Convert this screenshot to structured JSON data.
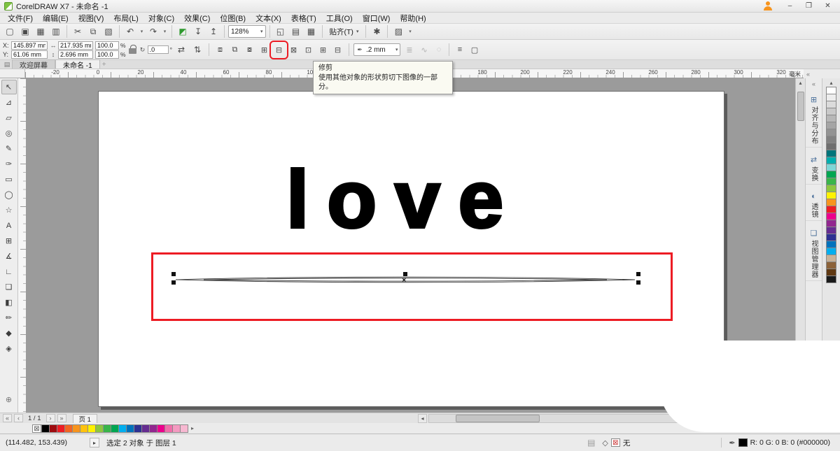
{
  "window": {
    "title": "CorelDRAW X7 - 未命名 -1"
  },
  "titlebar_icons": {
    "minimize": "–",
    "maximize": "❐",
    "close": "✕"
  },
  "icons": {
    "new_tab": "+",
    "doc": "▤",
    "collapse": "«",
    "up": "▴",
    "down": "▾",
    "left": "◂",
    "right": "▸",
    "none": "⊠",
    "clipboard": "▤",
    "nav": "▸",
    "fill": "◇",
    "outline_pen": "✒"
  },
  "menu": {
    "items": [
      {
        "id": "file",
        "label": "文件(F)"
      },
      {
        "id": "edit",
        "label": "编辑(E)"
      },
      {
        "id": "view",
        "label": "视图(V)"
      },
      {
        "id": "layout",
        "label": "布局(L)"
      },
      {
        "id": "object",
        "label": "对象(C)"
      },
      {
        "id": "effects",
        "label": "效果(C)"
      },
      {
        "id": "bitmaps",
        "label": "位图(B)"
      },
      {
        "id": "text",
        "label": "文本(X)"
      },
      {
        "id": "table",
        "label": "表格(T)"
      },
      {
        "id": "tools",
        "label": "工具(O)"
      },
      {
        "id": "window",
        "label": "窗口(W)"
      },
      {
        "id": "help",
        "label": "帮助(H)"
      }
    ]
  },
  "toolbar_std": {
    "zoom_value": "128%",
    "snap_label": "贴齐(T)",
    "items": [
      {
        "name": "new-document-button",
        "glyph": "▢"
      },
      {
        "name": "open-button",
        "glyph": "▣"
      },
      {
        "name": "save-button",
        "glyph": "▦"
      },
      {
        "name": "print-button",
        "glyph": "▥"
      },
      {
        "sep": true
      },
      {
        "name": "cut-button",
        "glyph": "✂"
      },
      {
        "name": "copy-button",
        "glyph": "⧉"
      },
      {
        "name": "paste-button",
        "glyph": "▧"
      },
      {
        "sep": true
      },
      {
        "name": "undo-button",
        "glyph": "↶",
        "dd": true
      },
      {
        "name": "redo-button",
        "glyph": "↷",
        "dd": true
      },
      {
        "sep": true
      },
      {
        "name": "welcome-screen-button",
        "glyph": "◩",
        "cls": "green"
      },
      {
        "name": "import-button",
        "glyph": "↧"
      },
      {
        "name": "export-button",
        "glyph": "↥"
      },
      {
        "sep": true
      },
      {
        "kind": "zoom"
      },
      {
        "sep": true
      },
      {
        "name": "full-screen-preview-button",
        "glyph": "◱"
      },
      {
        "name": "show-rulers-button",
        "glyph": "▤"
      },
      {
        "name": "show-grid-button",
        "glyph": "▦"
      },
      {
        "sep": true
      },
      {
        "kind": "snap"
      },
      {
        "sep": true
      },
      {
        "name": "options-button",
        "glyph": "✱"
      },
      {
        "sep": true
      },
      {
        "name": "application-launcher-button",
        "glyph": "▨",
        "dd": true
      }
    ]
  },
  "property_bar": {
    "x_label": "X:",
    "y_label": "Y:",
    "x_value": "145.897 mm",
    "y_value": "61.06 mm",
    "width_value": "217.935 mm",
    "height_value": "2.696 mm",
    "scale_h": "100.0",
    "scale_v": "100.0",
    "percent": "%",
    "angle": ".0",
    "degree": "°",
    "outline_value": ".2 mm",
    "shaping": [
      {
        "name": "group-button",
        "glyph": "⧈"
      },
      {
        "name": "ungroup-button",
        "glyph": "⧉"
      },
      {
        "name": "ungroup-all-button",
        "glyph": "⧇"
      },
      {
        "name": "weld-button",
        "glyph": "⊞"
      },
      {
        "name": "trim-button",
        "glyph": "⊟",
        "highlight": true
      },
      {
        "name": "intersect-button",
        "glyph": "⊠"
      },
      {
        "name": "simplify-button",
        "glyph": "⊡"
      },
      {
        "name": "front-minus-back-button",
        "glyph": "⊞"
      },
      {
        "name": "back-minus-front-button",
        "glyph": "⊟"
      }
    ],
    "extra": [
      {
        "name": "wrap-paragraph-text-button",
        "glyph": "≣",
        "dis": true
      },
      {
        "name": "convert-to-curves-button",
        "glyph": "∿",
        "dis": true
      },
      {
        "name": "open-curve-button",
        "glyph": "◌",
        "dis": true
      },
      {
        "sep": true
      },
      {
        "name": "align-and-distribute-button",
        "glyph": "≡"
      },
      {
        "name": "create-boundary-button",
        "glyph": "▢"
      }
    ]
  },
  "tooltip": {
    "title": "修剪",
    "body": "使用其他对象的形状剪切下图像的一部分。"
  },
  "doc_tabs": {
    "tabs": [
      {
        "label": "欢迎屏幕",
        "active": false
      },
      {
        "label": "未命名 -1",
        "active": true
      }
    ]
  },
  "ruler": {
    "unit": "毫米",
    "labels": [
      -20,
      0,
      20,
      40,
      60,
      80,
      100,
      120,
      140,
      160,
      180,
      200,
      220,
      240,
      260,
      280,
      300,
      320
    ]
  },
  "toolbox": {
    "tools": [
      {
        "name": "pick-tool",
        "glyph": "↖"
      },
      {
        "name": "shape-tool",
        "glyph": "⊿"
      },
      {
        "name": "crop-tool",
        "glyph": "▱"
      },
      {
        "name": "zoom-tool",
        "glyph": "◎"
      },
      {
        "name": "freehand-tool",
        "glyph": "✎"
      },
      {
        "name": "artistic-media-tool",
        "glyph": "✑"
      },
      {
        "name": "rectangle-tool",
        "glyph": "▭"
      },
      {
        "name": "ellipse-tool",
        "glyph": "◯"
      },
      {
        "name": "polygon-tool",
        "glyph": "☆"
      },
      {
        "name": "text-tool",
        "glyph": "A"
      },
      {
        "name": "table-tool",
        "glyph": "⊞"
      },
      {
        "name": "dimension-tool",
        "glyph": "∡"
      },
      {
        "name": "connector-tool",
        "glyph": "∟"
      },
      {
        "name": "drop-shadow-tool",
        "glyph": "❏"
      },
      {
        "name": "transparency-tool",
        "glyph": "◧"
      },
      {
        "name": "color-eyedropper-tool",
        "glyph": "✏"
      },
      {
        "name": "interactive-fill-tool",
        "glyph": "◆"
      },
      {
        "name": "smart-fill-tool",
        "glyph": "◈"
      }
    ]
  },
  "canvas": {
    "text": "love"
  },
  "dockers": {
    "tabs": [
      {
        "id": "align-distribute",
        "label": "对齐与分布",
        "icon": "⊞",
        "icon_name": "align-distribute-icon"
      },
      {
        "id": "transform",
        "label": "变换",
        "icon": "⇄",
        "icon_name": "transform-icon"
      },
      {
        "id": "lens",
        "label": "透镜",
        "icon": "◐",
        "icon_name": "lens-icon"
      },
      {
        "id": "view-manager",
        "label": "视图管理器",
        "icon": "❏",
        "icon_name": "view-manager-icon"
      }
    ]
  },
  "vpalette": {
    "colors": [
      "#ffffff",
      "#ededed",
      "#dbdbdb",
      "#c9c9c9",
      "#b7b7b7",
      "#a5a5a5",
      "#939393",
      "#818181",
      "#6f6f6f",
      "#00747a",
      "#00aeae",
      "#7fd6d6",
      "#00a651",
      "#39b54a",
      "#8dc63f",
      "#fff200",
      "#f7941d",
      "#ed1c24",
      "#ec008c",
      "#92278f",
      "#662d91",
      "#2e3192",
      "#0072bc",
      "#00aeef",
      "#c7b299",
      "#8c6239",
      "#603913",
      "#1a1a1a"
    ]
  },
  "bottom_palette": {
    "colors": [
      "#000000",
      "#9e0b0f",
      "#ed1c24",
      "#f26522",
      "#f7941d",
      "#ffc20e",
      "#fff200",
      "#8dc63f",
      "#39b54a",
      "#00a651",
      "#00aeef",
      "#0072bc",
      "#2e3192",
      "#662d91",
      "#92278f",
      "#ec008c",
      "#f06eaa",
      "#f49ac1",
      "#f7b8d1"
    ]
  },
  "page_nav": {
    "counter": "1 / 1",
    "page_tab": "页 1",
    "first": "«",
    "prev": "‹",
    "next": "›",
    "last": "»"
  },
  "status_bar": {
    "coords": "(114.482, 153.439)",
    "selection": "选定 2 对象 于 图层 1",
    "fill_none": "无",
    "outline_info": "R: 0 G: 0 B: 0 (#000000)"
  }
}
